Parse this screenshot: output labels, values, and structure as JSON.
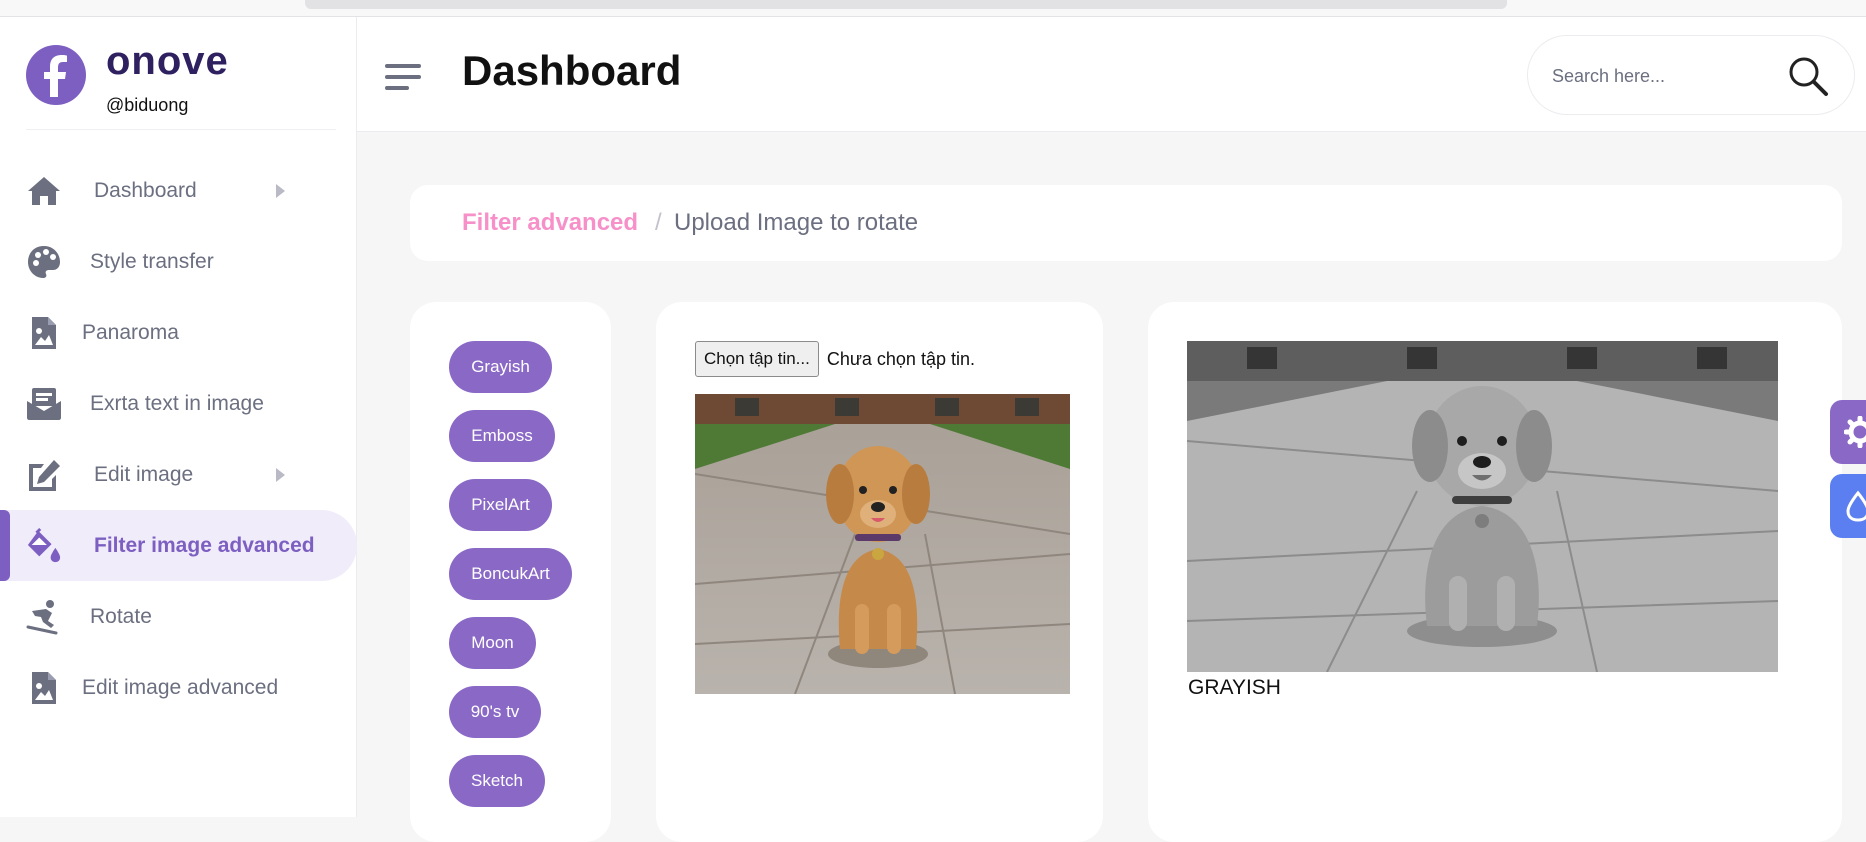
{
  "brand": {
    "logo_letter": "f",
    "name": "onove",
    "handle": "@biduong"
  },
  "sidebar": {
    "items": [
      {
        "label": "Dashboard",
        "icon": "home-icon",
        "has_submenu": true
      },
      {
        "label": "Style transfer",
        "icon": "palette-icon",
        "has_submenu": false
      },
      {
        "label": "Panaroma",
        "icon": "image-file-icon",
        "has_submenu": false
      },
      {
        "label": "Exrta text in image",
        "icon": "mail-bulk-icon",
        "has_submenu": false
      },
      {
        "label": "Edit image",
        "icon": "edit-icon",
        "has_submenu": true
      },
      {
        "label": "Filter image advanced",
        "icon": "paint-bucket-icon",
        "has_submenu": false,
        "active": true
      },
      {
        "label": "Rotate",
        "icon": "snowboarder-icon",
        "has_submenu": false
      },
      {
        "label": "Edit image advanced",
        "icon": "image-file-icon",
        "has_submenu": false
      }
    ]
  },
  "header": {
    "title": "Dashboard",
    "search_placeholder": "Search here..."
  },
  "breadcrumb": {
    "link": "Filter advanced",
    "separator": "/",
    "current": "Upload Image to rotate"
  },
  "filters": [
    "Grayish",
    "Emboss",
    "PixelArt",
    "BoncukArt",
    "Moon",
    "90's tv",
    "Sketch"
  ],
  "upload": {
    "button_label": "Chọn tập tin...",
    "status": "Chưa chọn tập tin."
  },
  "result": {
    "label": "GRAYISH"
  },
  "colors": {
    "accent": "#7d5fc2",
    "button": "#8a68c6",
    "breadcrumb_link": "#f790c9",
    "settings_tab": "#8a68c6",
    "theme_tab": "#5b7ff0"
  }
}
